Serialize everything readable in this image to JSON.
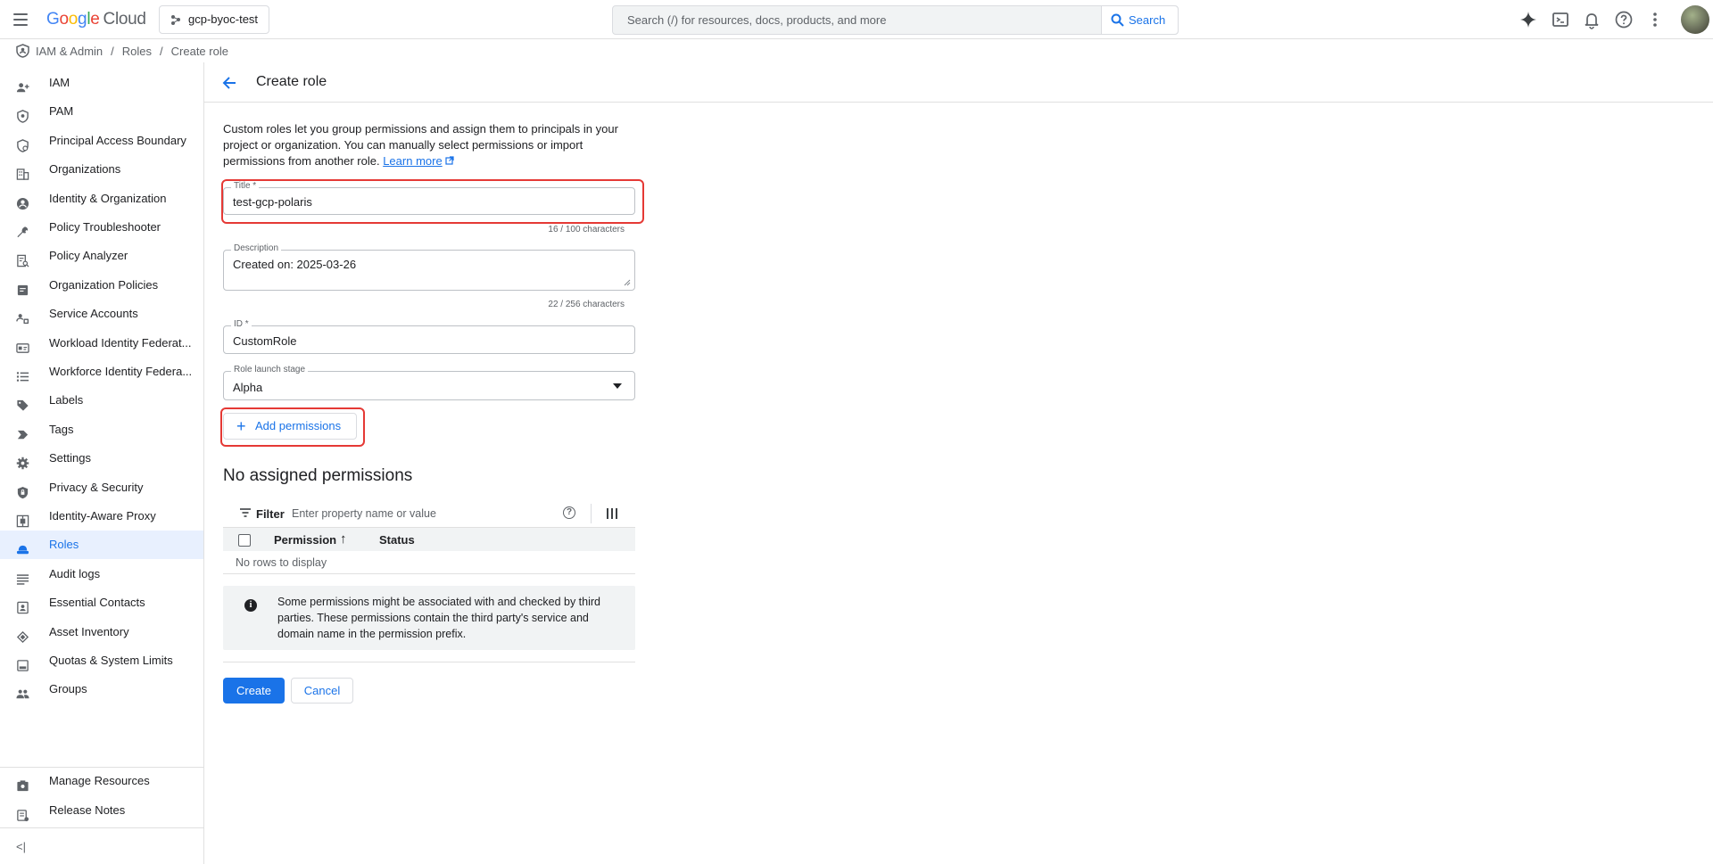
{
  "header": {
    "logo_google": "Google",
    "logo_cloud": "Cloud",
    "project": "gcp-byoc-test",
    "search_placeholder": "Search (/) for resources, docs, products, and more",
    "search_button": "Search"
  },
  "breadcrumb": {
    "items": [
      "IAM & Admin",
      "Roles",
      "Create role"
    ]
  },
  "sidebar": {
    "items": [
      {
        "label": "IAM",
        "icon": "person-add-icon"
      },
      {
        "label": "PAM",
        "icon": "shield-icon"
      },
      {
        "label": "Principal Access Boundary",
        "icon": "boundary-icon"
      },
      {
        "label": "Organizations",
        "icon": "building-icon"
      },
      {
        "label": "Identity & Organization",
        "icon": "account-circle-icon"
      },
      {
        "label": "Policy Troubleshooter",
        "icon": "wrench-icon"
      },
      {
        "label": "Policy Analyzer",
        "icon": "analyzer-icon"
      },
      {
        "label": "Organization Policies",
        "icon": "policy-doc-icon"
      },
      {
        "label": "Service Accounts",
        "icon": "service-account-icon"
      },
      {
        "label": "Workload Identity Federat...",
        "icon": "id-card-icon"
      },
      {
        "label": "Workforce Identity Federa...",
        "icon": "list-icon"
      },
      {
        "label": "Labels",
        "icon": "label-icon"
      },
      {
        "label": "Tags",
        "icon": "tag-icon"
      },
      {
        "label": "Settings",
        "icon": "gear-icon"
      },
      {
        "label": "Privacy & Security",
        "icon": "privacy-shield-icon"
      },
      {
        "label": "Identity-Aware Proxy",
        "icon": "proxy-icon"
      },
      {
        "label": "Roles",
        "icon": "roles-hat-icon",
        "active": true
      },
      {
        "label": "Audit logs",
        "icon": "audit-list-icon"
      },
      {
        "label": "Essential Contacts",
        "icon": "contacts-icon"
      },
      {
        "label": "Asset Inventory",
        "icon": "inventory-icon"
      },
      {
        "label": "Quotas & System Limits",
        "icon": "quota-icon"
      },
      {
        "label": "Groups",
        "icon": "groups-icon"
      }
    ],
    "bottom_items": [
      {
        "label": "Manage Resources",
        "icon": "manage-resources-icon"
      },
      {
        "label": "Release Notes",
        "icon": "release-notes-icon"
      }
    ],
    "collapse_glyph": "<|"
  },
  "page": {
    "title": "Create role",
    "intro": "Custom roles let you group permissions and assign them to principals in your project or organization. You can manually select permissions or import permissions from another role.",
    "learn_more": "Learn more"
  },
  "form": {
    "title_label": "Title *",
    "title_value": "test-gcp-polaris",
    "title_counter": "16 / 100 characters",
    "description_label": "Description",
    "description_value": "Created on: 2025-03-26",
    "description_counter": "22 / 256 characters",
    "id_label": "ID *",
    "id_value": "CustomRole",
    "stage_label": "Role launch stage",
    "stage_value": "Alpha",
    "add_permissions": "Add permissions"
  },
  "permissions": {
    "section_title": "No assigned permissions",
    "filter_label": "Filter",
    "filter_placeholder": "Enter property name or value",
    "columns": [
      "Permission",
      "Status"
    ],
    "empty_text": "No rows to display",
    "info_text": "Some permissions might be associated with and checked by third parties. These permissions contain the third party's service and domain name in the permission prefix."
  },
  "actions": {
    "create": "Create",
    "cancel": "Cancel"
  },
  "colors": {
    "accent": "#1a73e8",
    "highlight": "#e53935",
    "active_bg": "#e8f0fe"
  }
}
